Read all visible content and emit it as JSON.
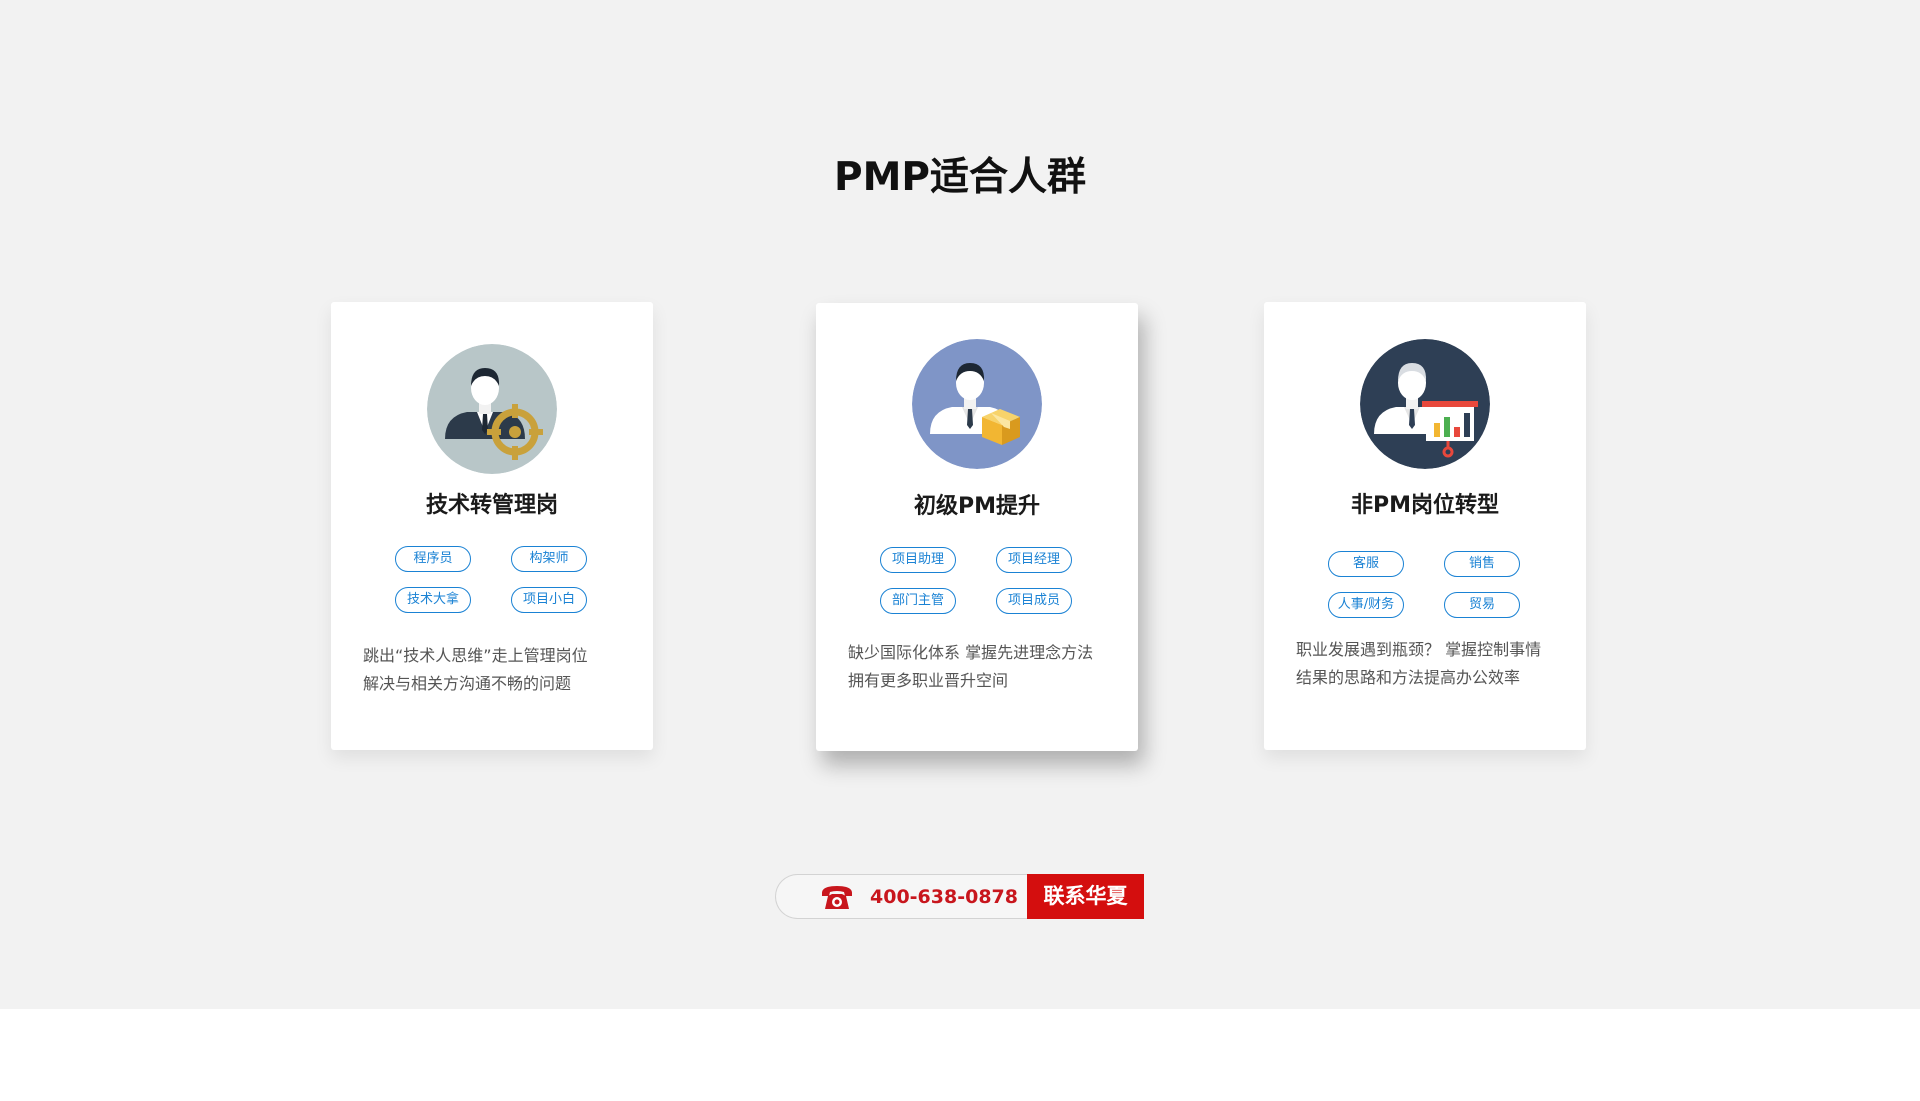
{
  "section": {
    "title": "PMP适合人群"
  },
  "cards": [
    {
      "title": "技术转管理岗",
      "avatar_icon": "manager-target-icon",
      "avatar_color": "#b8c6c8",
      "tags": [
        "程序员",
        "构架师",
        "技术大拿",
        "项目小白"
      ],
      "desc_lines": [
        "跳出“技术人思维”走上管理岗位",
        "解决与相关方沟通不畅的问题"
      ]
    },
    {
      "title": "初级PM提升",
      "avatar_icon": "manager-package-icon",
      "avatar_color": "#7f95c7",
      "tags": [
        "项目助理",
        "项目经理",
        "部门主管",
        "项目成员"
      ],
      "desc_lines": [
        "缺少国际化体系 掌握先进理念方法",
        "拥有更多职业晋升空间"
      ]
    },
    {
      "title": "非PM岗位转型",
      "avatar_icon": "presenter-chart-icon",
      "avatar_color": "#2e3f55",
      "tags": [
        "客服",
        "销售",
        "人事/财务",
        "贸易"
      ],
      "desc_lines": [
        "职业发展遇到瓶颈？ 掌握控制事情",
        "结果的思路和方法提高办公效率"
      ]
    }
  ],
  "contact": {
    "phone_icon": "telephone-icon",
    "phone": "400-638-0878",
    "button_label": "联系华夏",
    "accent_color": "#d40e0e"
  }
}
